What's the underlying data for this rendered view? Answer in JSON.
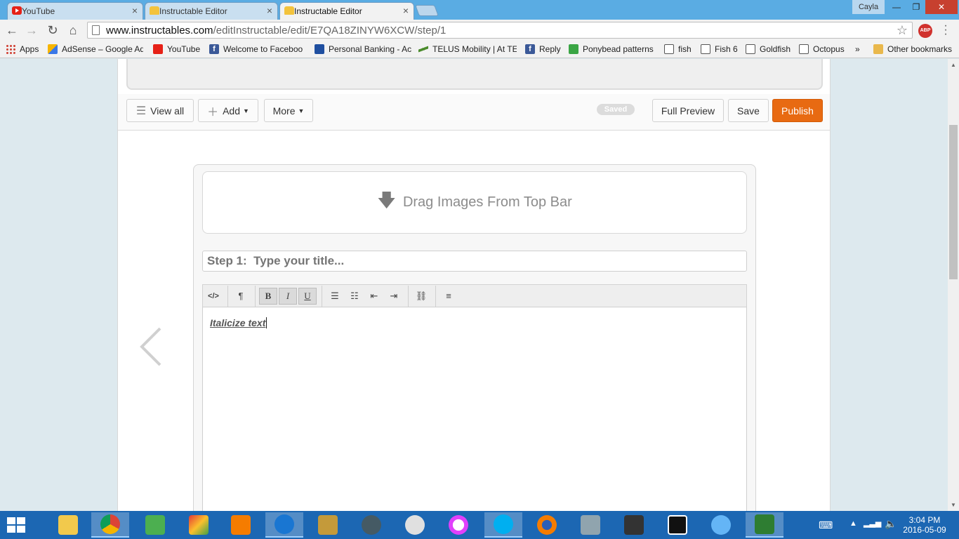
{
  "browser": {
    "tabs": [
      {
        "title": "YouTube",
        "active": false
      },
      {
        "title": "Instructable Editor",
        "active": false
      },
      {
        "title": "Instructable Editor",
        "active": true
      }
    ],
    "user": "Cayla",
    "url_host": "www.instructables.com",
    "url_path": "/editInstructable/edit/E7QA18ZINYW6XCW/step/1",
    "abp_label": "ABP"
  },
  "bookmarks": [
    {
      "label": "Apps",
      "icon": "apps-icon"
    },
    {
      "label": "AdSense – Google Ad",
      "icon": "adsense-icon"
    },
    {
      "label": "YouTube",
      "icon": "youtube-icon"
    },
    {
      "label": "Welcome to Faceboo",
      "icon": "facebook-icon"
    },
    {
      "label": "Personal Banking - Ac",
      "icon": "bank-icon"
    },
    {
      "label": "TELUS Mobility | At TE",
      "icon": "telus-icon"
    },
    {
      "label": "Reply",
      "icon": "facebook-icon"
    },
    {
      "label": "Ponybead patterns",
      "icon": "ponybead-icon"
    },
    {
      "label": "fish",
      "icon": "page-icon"
    },
    {
      "label": "Fish 6",
      "icon": "page-icon"
    },
    {
      "label": "Goldfish",
      "icon": "page-icon"
    },
    {
      "label": "Octopus",
      "icon": "page-icon"
    }
  ],
  "bookmarks_more": "»",
  "other_bookmarks": "Other bookmarks",
  "editbar": {
    "view_all": "View all",
    "add": "Add",
    "more": "More",
    "saved": "Saved",
    "full_preview": "Full Preview",
    "save": "Save",
    "publish": "Publish"
  },
  "step": {
    "drop_text": "Drag Images From Top Bar",
    "title_placeholder": "Step 1:  Type your title...",
    "body_text": "Italicize text"
  },
  "rte_tools": {
    "html": "</>",
    "paragraph": "¶",
    "bold": "B",
    "italic": "I",
    "underline": "U"
  },
  "clock": {
    "time": "3:04 PM",
    "date": "2016-05-09"
  },
  "colors": {
    "accent": "#e86a12",
    "taskbar": "#1c67b3",
    "tabstrip": "#5aace3"
  }
}
